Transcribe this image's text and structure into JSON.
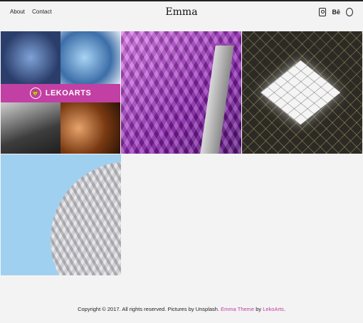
{
  "header": {
    "nav": [
      "About",
      "Contact"
    ],
    "brand": "Emma",
    "social": [
      {
        "name": "instagram-icon"
      },
      {
        "name": "behance-icon",
        "label": "Bē"
      },
      {
        "name": "dribbble-icon"
      }
    ]
  },
  "gallery": {
    "banner_text": "LEKOARTS"
  },
  "footer": {
    "prefix": "Copyright © 2017. All rights reserved. Pictures by Unsplash. ",
    "theme_link": "Emma Theme",
    "middle": " by ",
    "author_link": "LekoArts",
    "suffix": "."
  },
  "colors": {
    "accent": "#c23fa3",
    "background": "#f3f3f3"
  }
}
